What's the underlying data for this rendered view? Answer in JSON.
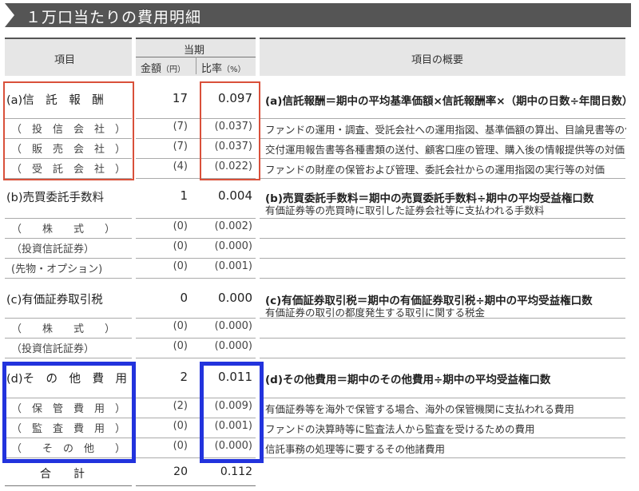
{
  "title": "１万口当たりの費用明細",
  "header": {
    "item": "項目",
    "period": "当期",
    "amount": "金額",
    "amount_unit": "（円）",
    "ratio": "比率",
    "ratio_unit": "（%）",
    "summary": "項目の概要"
  },
  "rows": [
    {
      "label": "(a)信　託　報　酬",
      "amount": "17",
      "ratio": "0.097",
      "desc": "(a)信託報酬＝期中の平均基準価額×信託報酬率×（期中の日数÷年間日数）",
      "desc_sub": ""
    },
    {
      "label": "（　投　信　会　社　）",
      "amount": "(7)",
      "ratio": "(0.037)",
      "desc": "ファンドの運用・調査、受託会社への運用指図、基準価額の算出、目論見書等の作成等の対価",
      "desc_sub": ""
    },
    {
      "label": "（　販　売　会　社　）",
      "amount": "(7)",
      "ratio": "(0.037)",
      "desc": "交付運用報告書等各種書類の送付、顧客口座の管理、購入後の情報提供等の対価",
      "desc_sub": ""
    },
    {
      "label": "（　受　託　会　社　）",
      "amount": "(4)",
      "ratio": "(0.022)",
      "desc": "ファンドの財産の保管および管理、委託会社からの運用指図の実行等の対価",
      "desc_sub": ""
    },
    {
      "label": "(b)売買委託手数料",
      "amount": "1",
      "ratio": "0.004",
      "desc": "(b)売買委託手数料＝期中の売買委託手数料÷期中の平均受益権口数",
      "desc_sub": "有価証券等の売買時に取引した証券会社等に支払われる手数料"
    },
    {
      "label": "（　　株　　式　　）",
      "amount": "(0)",
      "ratio": "(0.002)",
      "desc": "",
      "desc_sub": ""
    },
    {
      "label": "（投資信託証券）",
      "amount": "(0)",
      "ratio": "(0.000)",
      "desc": "",
      "desc_sub": ""
    },
    {
      "label": "(先物・オプション)",
      "amount": "(0)",
      "ratio": "(0.001)",
      "desc": "",
      "desc_sub": ""
    },
    {
      "label": "(c)有価証券取引税",
      "amount": "0",
      "ratio": "0.000",
      "desc": "(c)有価証券取引税＝期中の有価証券取引税÷期中の平均受益権口数",
      "desc_sub": "有価証券の取引の都度発生する取引に関する税金"
    },
    {
      "label": "（　　株　　式　　）",
      "amount": "(0)",
      "ratio": "(0.000)",
      "desc": "",
      "desc_sub": ""
    },
    {
      "label": "（投資信託証券）",
      "amount": "(0)",
      "ratio": "(0.000)",
      "desc": "",
      "desc_sub": ""
    },
    {
      "label": "(d)そ　の　他　費　用",
      "amount": "2",
      "ratio": "0.011",
      "desc": "(d)その他費用＝期中のその他費用÷期中の平均受益権口数",
      "desc_sub": ""
    },
    {
      "label": "（　保　管　費　用　）",
      "amount": "(2)",
      "ratio": "(0.009)",
      "desc": "有価証券等を海外で保管する場合、海外の保管機関に支払われる費用",
      "desc_sub": ""
    },
    {
      "label": "（　監　査　費　用　）",
      "amount": "(0)",
      "ratio": "(0.001)",
      "desc": "ファンドの決算時等に監査法人から監査を受けるための費用",
      "desc_sub": ""
    },
    {
      "label": "（　　そ　の　他　　）",
      "amount": "(0)",
      "ratio": "(0.000)",
      "desc": "信託事務の処理等に要するその他諸費用",
      "desc_sub": ""
    }
  ],
  "total": {
    "label": "合　　計",
    "amount": "20",
    "ratio": "0.112"
  }
}
